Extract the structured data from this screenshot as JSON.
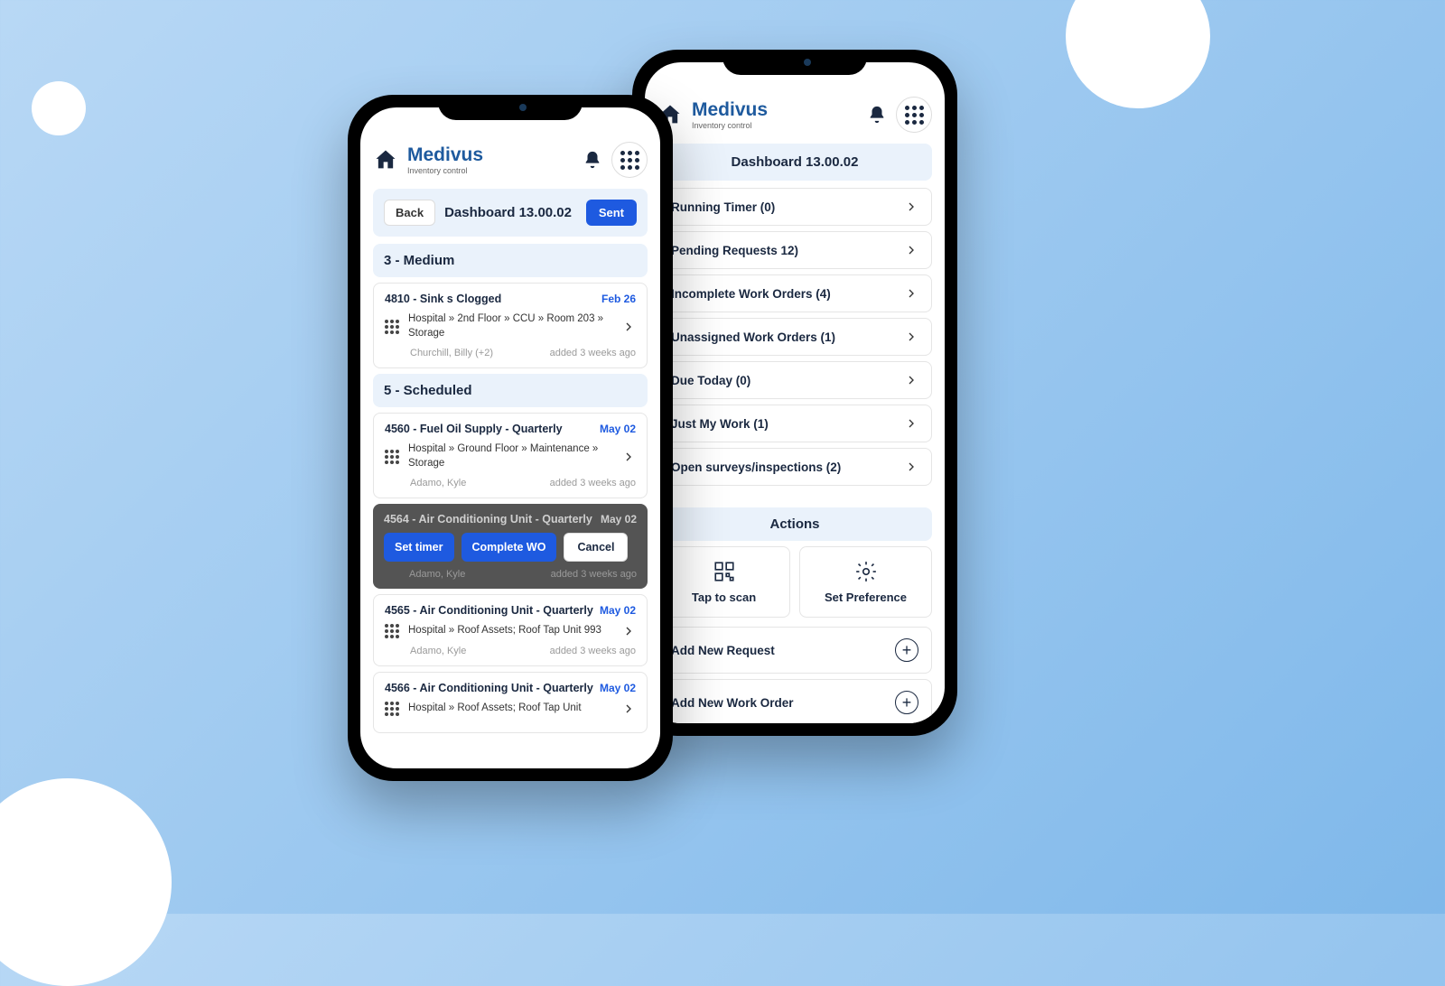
{
  "app": {
    "name": "Medivus",
    "tagline": "Inventory control"
  },
  "left": {
    "back": "Back",
    "title": "Dashboard 13.00.02",
    "sent": "Sent",
    "groups": [
      {
        "header": "3 - Medium",
        "items": [
          {
            "title": "4810 - Sink s Clogged",
            "date": "Feb 26",
            "path": "Hospital » 2nd Floor » CCU » Room 203 » Storage",
            "assignee": "Churchill, Billy (+2)",
            "added": "added 3 weeks ago",
            "overlay": false
          }
        ]
      },
      {
        "header": "5 - Scheduled",
        "items": [
          {
            "title": "4560 - Fuel Oil Supply - Quarterly",
            "date": "May 02",
            "path": "Hospital » Ground Floor » Maintenance » Storage",
            "assignee": "Adamo, Kyle",
            "added": "added 3 weeks ago",
            "overlay": false
          },
          {
            "title": "4564 - Air Conditioning Unit - Quarterly",
            "date": "May 02",
            "path": "",
            "assignee": "Adamo, Kyle",
            "added": "added 3 weeks ago",
            "overlay": true,
            "actions": {
              "set_timer": "Set timer",
              "complete": "Complete WO",
              "cancel": "Cancel"
            }
          },
          {
            "title": "4565 - Air Conditioning Unit - Quarterly",
            "date": "May 02",
            "path": "Hospital » Roof Assets; Roof Tap Unit 993",
            "assignee": "Adamo, Kyle",
            "added": "added 3 weeks ago",
            "overlay": false
          },
          {
            "title": "4566 - Air Conditioning Unit - Quarterly",
            "date": "May 02",
            "path": "Hospital » Roof Assets; Roof Tap Unit",
            "assignee": "",
            "added": "",
            "overlay": false
          }
        ]
      }
    ]
  },
  "right": {
    "title": "Dashboard 13.00.02",
    "rows": [
      "Running Timer (0)",
      "Pending Requests 12)",
      "Incomplete Work Orders (4)",
      "Unassigned Work Orders (1)",
      "Due Today (0)",
      "Just My Work (1)",
      "Open surveys/inspections (2)"
    ],
    "actions_header": "Actions",
    "tiles": {
      "scan": "Tap to scan",
      "pref": "Set Preference"
    },
    "add": {
      "request": "Add New Request",
      "workorder": "Add New Work Order"
    }
  }
}
